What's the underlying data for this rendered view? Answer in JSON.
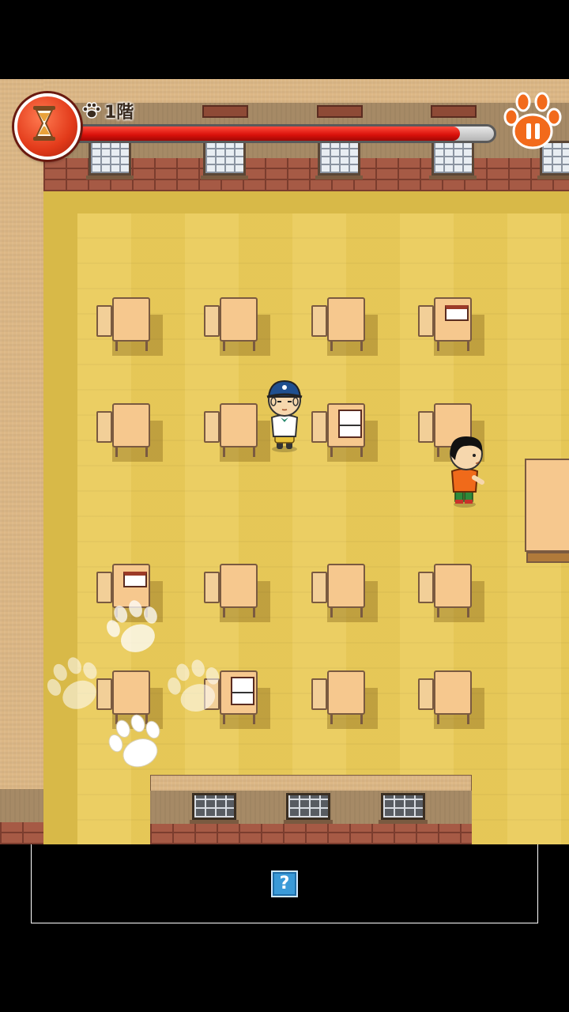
{
  "hud": {
    "floor_label": "1階",
    "timer_remaining_fraction": 0.92,
    "icons": {
      "timer": "hourglass-icon",
      "pause": "paw-pause-icon",
      "floor": "paw-icon"
    }
  },
  "classroom": {
    "desks": [
      {
        "row": 1,
        "col": 1,
        "item": "none"
      },
      {
        "row": 1,
        "col": 2,
        "item": "none"
      },
      {
        "row": 1,
        "col": 3,
        "item": "none"
      },
      {
        "row": 1,
        "col": 4,
        "item": "paper"
      },
      {
        "row": 2,
        "col": 1,
        "item": "none"
      },
      {
        "row": 2,
        "col": 2,
        "item": "none"
      },
      {
        "row": 2,
        "col": 3,
        "item": "paper-stack"
      },
      {
        "row": 2,
        "col": 4,
        "item": "none"
      },
      {
        "row": 3,
        "col": 1,
        "item": "paper"
      },
      {
        "row": 3,
        "col": 2,
        "item": "none"
      },
      {
        "row": 3,
        "col": 3,
        "item": "none"
      },
      {
        "row": 3,
        "col": 4,
        "item": "none"
      },
      {
        "row": 4,
        "col": 1,
        "item": "none"
      },
      {
        "row": 4,
        "col": 2,
        "item": "paper-stack"
      },
      {
        "row": 4,
        "col": 3,
        "item": "none"
      },
      {
        "row": 4,
        "col": 4,
        "item": "none"
      }
    ],
    "characters": [
      "player-boy-blue-cap",
      "student-orange-shirt"
    ]
  },
  "dialog": {
    "hint_label": "?"
  },
  "colors": {
    "floor": "#eacb59",
    "timer_fill": "#e8140e",
    "hint_button": "#3a9ad8",
    "pause_button": "#f26a1b"
  }
}
